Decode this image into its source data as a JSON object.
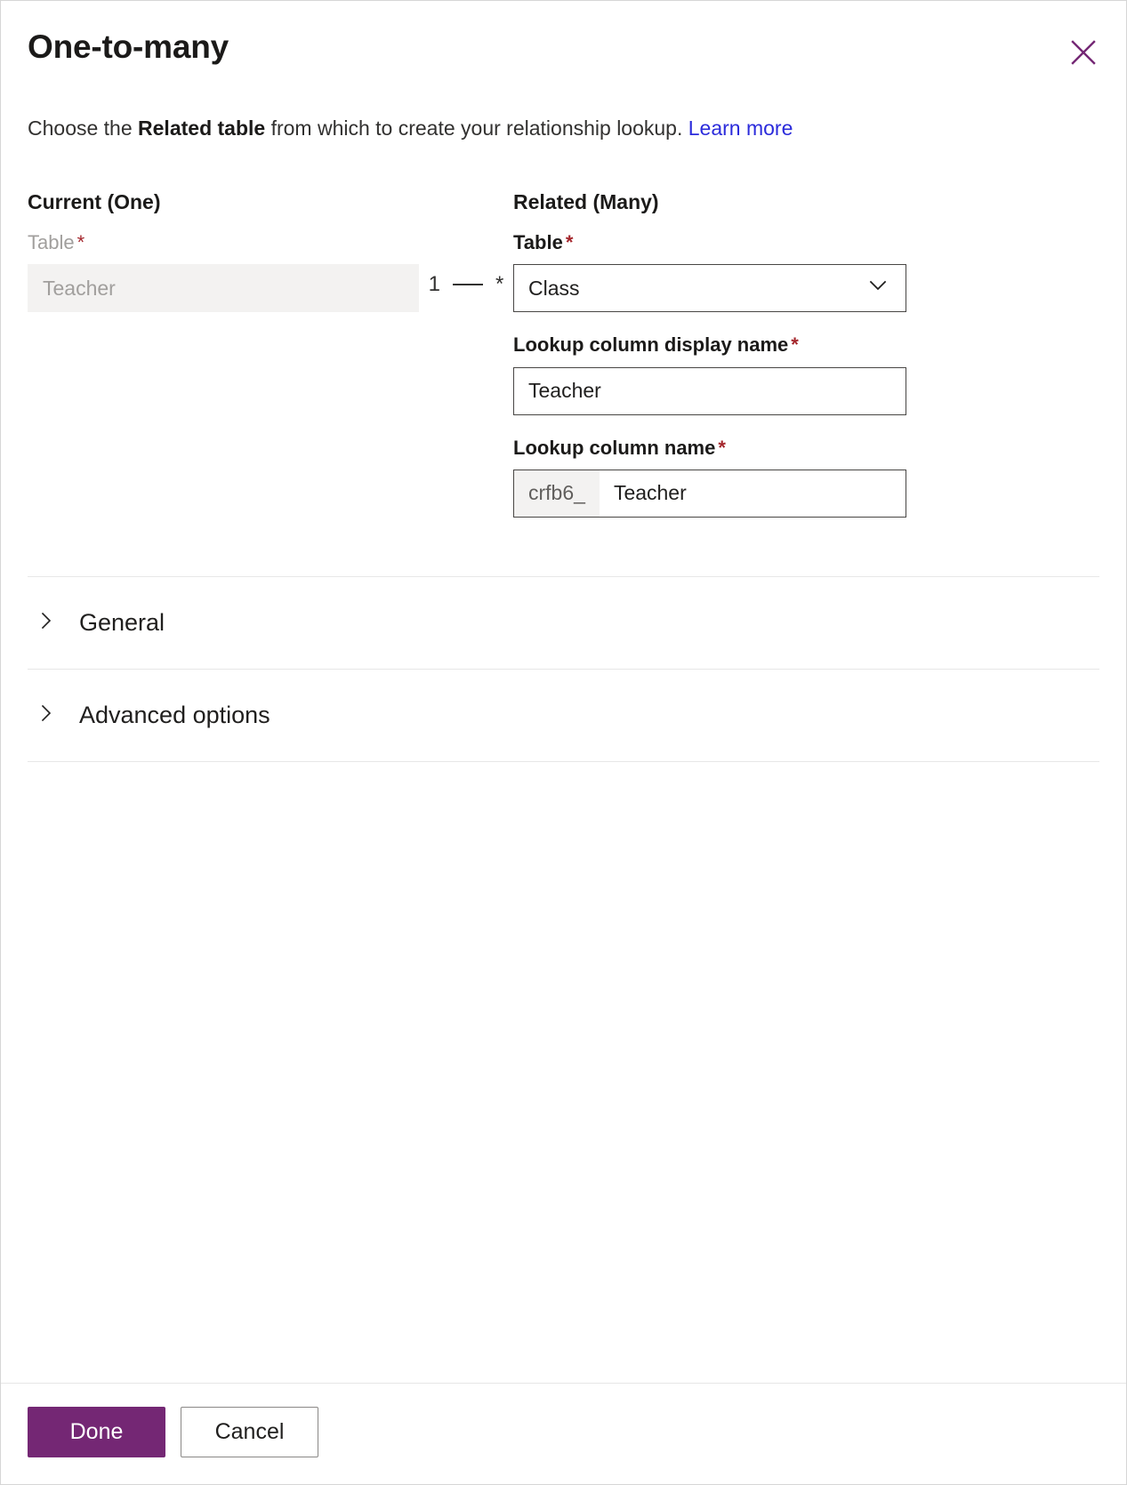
{
  "dialog": {
    "title": "One-to-many",
    "close_icon": "close-icon",
    "description": {
      "before": "Choose the ",
      "bold": "Related table",
      "after": " from which to create your relationship lookup. ",
      "link": "Learn more"
    }
  },
  "colors": {
    "accent": "#742774",
    "link": "#2b2bdb",
    "required": "#a4262c",
    "disabled_text": "#a19f9d",
    "disabled_bg": "#f3f2f1",
    "border": "#484644",
    "divider": "#e7e7e7"
  },
  "current": {
    "heading": "Current (One)",
    "table": {
      "label": "Table",
      "required_marker": "*",
      "value": "Teacher",
      "disabled": true
    }
  },
  "cardinality": {
    "one": "1",
    "many": "*",
    "connector": "—"
  },
  "related": {
    "heading": "Related (Many)",
    "table": {
      "label": "Table",
      "required_marker": "*",
      "value": "Class",
      "chevron_icon": "chevron-down-icon"
    },
    "display_name": {
      "label": "Lookup column display name",
      "required_marker": "*",
      "value": "Teacher"
    },
    "column_name": {
      "label": "Lookup column name",
      "required_marker": "*",
      "prefix": "crfb6_",
      "value": "Teacher"
    }
  },
  "sections": [
    {
      "label": "General",
      "chevron_icon": "chevron-right-icon",
      "expanded": false
    },
    {
      "label": "Advanced options",
      "chevron_icon": "chevron-right-icon",
      "expanded": false
    }
  ],
  "footer": {
    "done_label": "Done",
    "cancel_label": "Cancel"
  }
}
